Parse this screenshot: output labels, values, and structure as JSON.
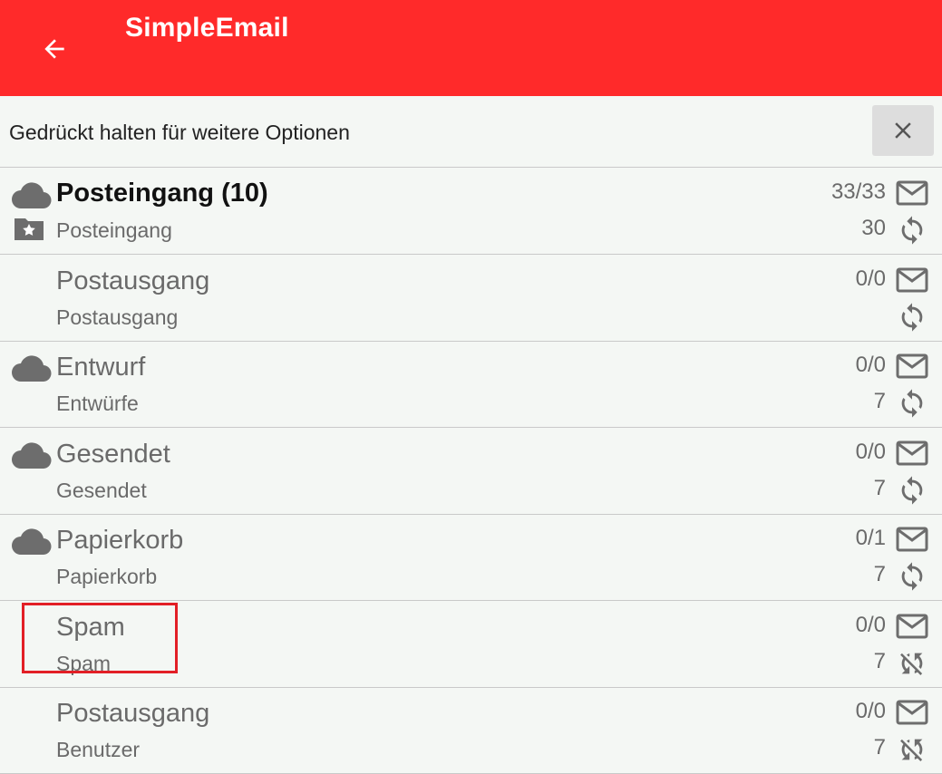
{
  "app": {
    "title": "SimpleEmail",
    "back_icon": "arrow-back-icon",
    "accent_color": "#ff2a2a"
  },
  "hint": {
    "text": "Gedrückt halten für weitere Optionen",
    "close_icon": "close-icon"
  },
  "folders": [
    {
      "name": "Posteingang (10)",
      "sub": "Posteingang",
      "count": "33/33",
      "sync_count": "30",
      "cloud": true,
      "primary": true,
      "sync_state": "sync"
    },
    {
      "name": "Postausgang",
      "sub": "Postausgang",
      "count": "0/0",
      "sync_count": "",
      "cloud": false,
      "primary": false,
      "sync_state": "sync"
    },
    {
      "name": "Entwurf",
      "sub": "Entwürfe",
      "count": "0/0",
      "sync_count": "7",
      "cloud": true,
      "primary": false,
      "sync_state": "sync"
    },
    {
      "name": "Gesendet",
      "sub": "Gesendet",
      "count": "0/0",
      "sync_count": "7",
      "cloud": true,
      "primary": false,
      "sync_state": "sync"
    },
    {
      "name": "Papierkorb",
      "sub": "Papierkorb",
      "count": "0/1",
      "sync_count": "7",
      "cloud": true,
      "primary": false,
      "sync_state": "sync"
    },
    {
      "name": "Spam",
      "sub": "Spam",
      "count": "0/0",
      "sync_count": "7",
      "cloud": false,
      "primary": false,
      "sync_state": "sync-disabled",
      "highlighted": true
    },
    {
      "name": "Postausgang",
      "sub": "Benutzer",
      "count": "0/0",
      "sync_count": "7",
      "cloud": false,
      "primary": false,
      "sync_state": "sync-disabled"
    }
  ]
}
